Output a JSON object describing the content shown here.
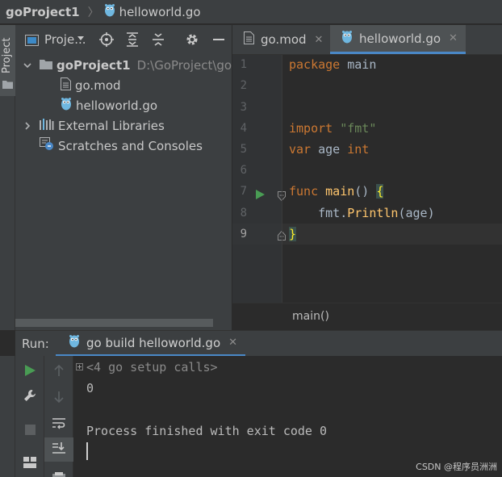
{
  "breadcrumb": {
    "project": "goProject1",
    "file": "helloworld.go"
  },
  "tool_stripe": {
    "project_label": "Project"
  },
  "project_panel": {
    "title": "Proje...",
    "toolbar_icons": [
      "locate-icon",
      "expand-all-icon",
      "collapse-all-icon",
      "settings-icon",
      "hide-icon"
    ],
    "tree": {
      "root": {
        "name": "goProject1",
        "path": "D:\\GoProject\\goP"
      },
      "children": [
        {
          "name": "go.mod",
          "icon": "file-icon"
        },
        {
          "name": "helloworld.go",
          "icon": "gopher-icon"
        }
      ],
      "external_libraries": "External Libraries",
      "scratches": "Scratches and Consoles"
    }
  },
  "editor": {
    "tabs": [
      {
        "label": "go.mod",
        "active": false
      },
      {
        "label": "helloworld.go",
        "active": true
      }
    ],
    "line_numbers": [
      "1",
      "2",
      "3",
      "4",
      "5",
      "6",
      "7",
      "8",
      "9"
    ],
    "current_line": "9",
    "code": {
      "l1_kw": "package",
      "l1_rest": " main",
      "l4_kw": "import",
      "l4_str": "\"fmt\"",
      "l5_kw": "var",
      "l5_name": " age ",
      "l5_type": "int",
      "l7_kw": "func",
      "l7_fn": "main",
      "l7_parens": "() ",
      "l7_brace": "{",
      "l8_indent": "    ",
      "l8_pkg": "fmt",
      "l8_dot": ".",
      "l8_fn": "Println",
      "l8_args": "(age)",
      "l9_brace": "}"
    },
    "status_breadcrumb": "main()"
  },
  "run_panel": {
    "label": "Run:",
    "tab_label": "go build helloworld.go",
    "console": {
      "folded": "<4 go setup calls>",
      "output": "0",
      "exit_message": "Process finished with exit code 0"
    }
  },
  "watermark": "CSDN @程序员洲洲",
  "colors": {
    "keyword": "#cc7832",
    "string": "#6a8759",
    "function": "#ffc66d",
    "accent": "#4a88c7",
    "run_green": "#499c54"
  }
}
